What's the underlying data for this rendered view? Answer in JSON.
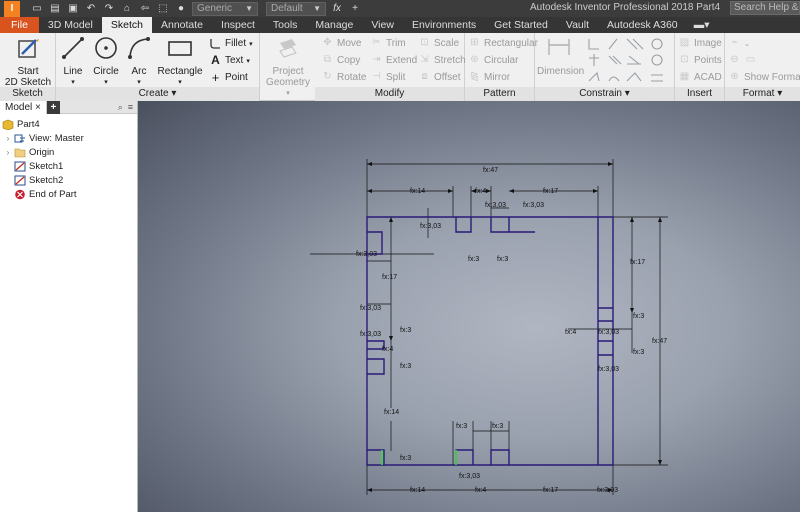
{
  "app": {
    "title": "Autodesk Inventor Professional 2018   Part4",
    "logo": "I",
    "search_placeholder": "Search Help & Commands"
  },
  "quick_access": {
    "material_combo": "Generic",
    "appearance_combo": "Default",
    "icons": [
      "new-icon",
      "open-icon",
      "save-icon",
      "undo-icon",
      "redo-icon",
      "home-icon",
      "return-icon",
      "select-icon",
      "color-icon",
      "fx-icon",
      "plus-icon"
    ]
  },
  "tabs": [
    "File",
    "3D Model",
    "Sketch",
    "Annotate",
    "Inspect",
    "Tools",
    "Manage",
    "View",
    "Environments",
    "Get Started",
    "Vault",
    "Autodesk A360"
  ],
  "active_tab": "Sketch",
  "ribbon": {
    "sketch_panel": {
      "title": "Sketch",
      "start_line1": "Start",
      "start_line2": "2D Sketch"
    },
    "create_panel": {
      "title": "Create",
      "line": "Line",
      "circle": "Circle",
      "arc": "Arc",
      "rectangle": "Rectangle",
      "fillet": "Fillet",
      "text": "Text",
      "point": "Point"
    },
    "project_geometry": {
      "line1": "Project",
      "line2": "Geometry"
    },
    "modify_panel": {
      "title": "Modify",
      "move": "Move",
      "trim": "Trim",
      "scale": "Scale",
      "copy": "Copy",
      "extend": "Extend",
      "stretch": "Stretch",
      "rotate": "Rotate",
      "split": "Split",
      "offset": "Offset"
    },
    "pattern_panel": {
      "title": "Pattern",
      "rectangular": "Rectangular",
      "circular": "Circular",
      "mirror": "Mirror"
    },
    "constrain_panel": {
      "title": "Constrain",
      "dimension": "Dimension"
    },
    "insert_panel": {
      "title": "Insert",
      "image": "Image",
      "points": "Points",
      "acad": "ACAD"
    },
    "format_panel": {
      "title": "Format",
      "show_format": "Show Format"
    }
  },
  "browser": {
    "tab": "Model",
    "nodes": [
      {
        "label": "Part4",
        "icon": "part-icon"
      },
      {
        "label": "View: Master",
        "icon": "view-icon"
      },
      {
        "label": "Origin",
        "icon": "folder-icon"
      },
      {
        "label": "Sketch1",
        "icon": "sketch-icon"
      },
      {
        "label": "Sketch2",
        "icon": "sketch-icon"
      },
      {
        "label": "End of Part",
        "icon": "end-of-part-icon"
      }
    ]
  },
  "sketch": {
    "line_color": "#2a1a78",
    "highlight_color": "#3cdc3c",
    "dimensions": {
      "total_width": "fx:47",
      "total_height": "fx:47",
      "top_left": "fx:14",
      "top_slot": "fx:4",
      "top_right": "fx:17",
      "top_depth_a": "fx:3,03",
      "top_depth_b": "fx:3,03",
      "depth_left_top": "fx:3,03",
      "left_offset": "fx:3,03",
      "slot_w_a": "fx:3",
      "slot_w_b": "fx:3",
      "left_17": "fx:17",
      "left_depth_a": "fx:3,03",
      "left_depth_b": "fx:3,03",
      "left_depth_c": "fx:3,03",
      "left_3a": "fx:3",
      "left_4": "fx:4",
      "left_3b": "fx:3",
      "left_14": "fx:14",
      "left_3c": "fx:3",
      "right_17": "fx:17",
      "right_3a": "fx:3",
      "right_4": "fx:4",
      "right_depth_a": "fx:3,03",
      "right_3b": "fx:3",
      "right_depth_b": "fx:3,03",
      "bottom_slot_w_a": "fx:3",
      "bottom_slot_w_b": "fx:3",
      "bottom_depth": "fx:3,03",
      "bottom_14": "fx:14",
      "bottom_4": "fx:4",
      "bottom_17": "fx:17",
      "bottom_depth_right": "fx:3,03"
    }
  }
}
